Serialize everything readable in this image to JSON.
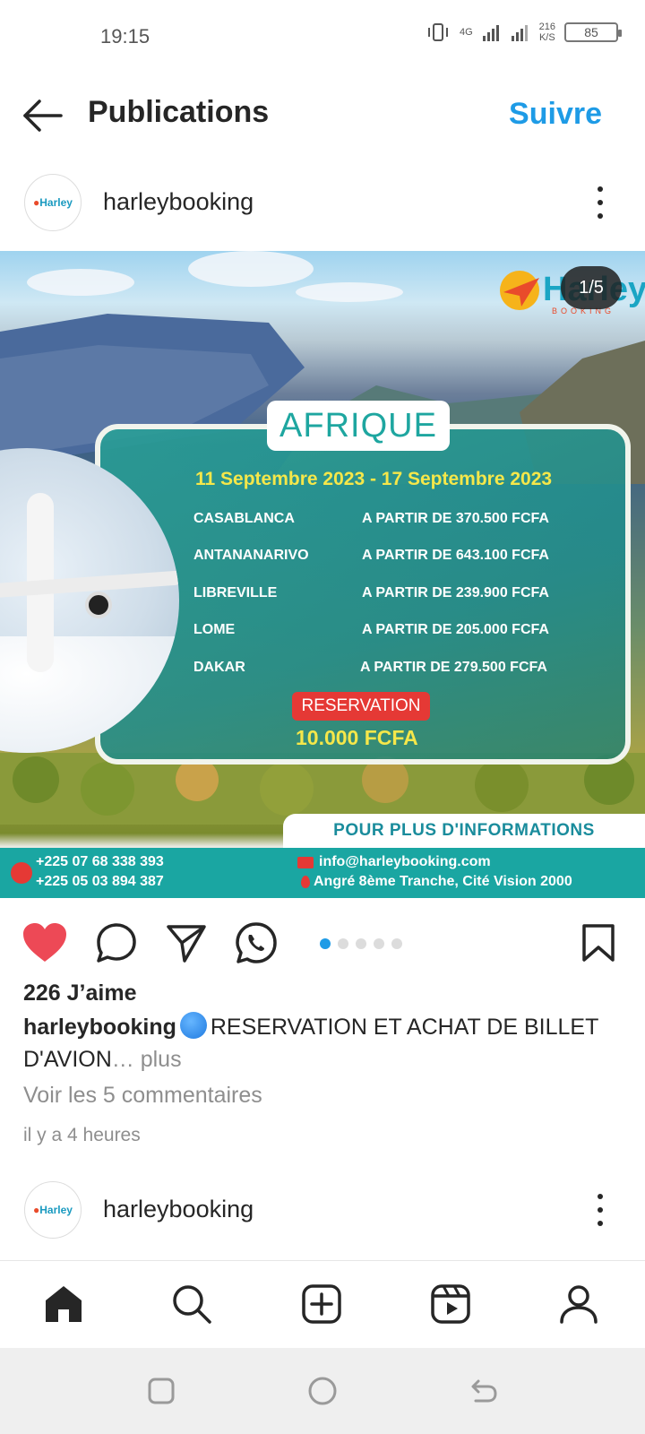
{
  "status_bar": {
    "time": "19:15",
    "network": "4G",
    "speed_value": "216",
    "speed_unit": "K/S",
    "battery": "85"
  },
  "header": {
    "title": "Publications",
    "follow_label": "Suivre"
  },
  "post": {
    "username": "harleybooking",
    "avatar_text": "Harley",
    "slide_counter": "1/5",
    "image": {
      "brand": "Harley",
      "brand_sub": "BOOKING",
      "title": "AFRIQUE",
      "dates": "11 Septembre 2023 - 17 Septembre 2023",
      "fares": [
        {
          "city": "CASABLANCA",
          "price": "A PARTIR DE 370.500 FCFA"
        },
        {
          "city": "ANTANANARIVO",
          "price": "A PARTIR DE 643.100 FCFA"
        },
        {
          "city": "LIBREVILLE",
          "price": "A PARTIR DE 239.900 FCFA"
        },
        {
          "city": "LOME",
          "price": "A PARTIR DE 205.000 FCFA"
        },
        {
          "city": "DAKAR",
          "price": "A PARTIR DE 279.500 FCFA"
        }
      ],
      "reservation_label": "RESERVATION",
      "reservation_price": "10.000 FCFA",
      "info_strip": "POUR PLUS D'INFORMATIONS",
      "phone_1": "+225 07 68 338 393",
      "phone_2": "+225 05 03 894 387",
      "email": "info@harleybooking.com",
      "address": "Angré 8ème Tranche, Cité Vision 2000"
    },
    "slide_count": 5,
    "active_slide": 1,
    "likes": "226 J’aime",
    "caption_user": "harleybooking",
    "caption_text": "RESERVATION ET ACHAT DE BILLET D'AVION",
    "caption_more": "… plus",
    "view_comments": "Voir les 5 commentaires",
    "time_ago": "il y a 4 heures"
  },
  "next_post": {
    "username": "harleybooking",
    "avatar_text": "Harley"
  },
  "colors": {
    "accent": "#1e9be6",
    "like": "#ed4956",
    "teal": "#1aa6a2",
    "yellow": "#f5e74a"
  },
  "icons": {
    "back": "back-arrow-icon",
    "like": "heart-icon",
    "comment": "comment-icon",
    "share": "send-icon",
    "whatsapp": "whatsapp-icon",
    "save": "bookmark-icon",
    "home": "home-icon",
    "search": "search-icon",
    "create": "add-post-icon",
    "reels": "reels-icon",
    "profile": "profile-icon"
  }
}
